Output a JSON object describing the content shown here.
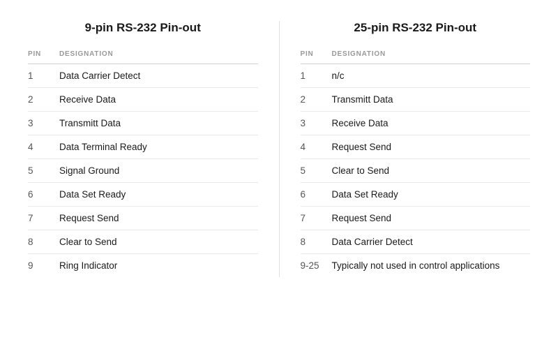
{
  "left_table": {
    "title": "9-pin RS-232 Pin-out",
    "col_pin": "PIN",
    "col_designation": "DESIGNATION",
    "rows": [
      {
        "pin": "1",
        "designation": "Data Carrier Detect"
      },
      {
        "pin": "2",
        "designation": "Receive Data"
      },
      {
        "pin": "3",
        "designation": "Transmitt Data"
      },
      {
        "pin": "4",
        "designation": "Data Terminal Ready"
      },
      {
        "pin": "5",
        "designation": "Signal Ground"
      },
      {
        "pin": "6",
        "designation": "Data Set Ready"
      },
      {
        "pin": "7",
        "designation": "Request Send"
      },
      {
        "pin": "8",
        "designation": "Clear to Send"
      },
      {
        "pin": "9",
        "designation": "Ring Indicator"
      }
    ]
  },
  "right_table": {
    "title": "25-pin RS-232 Pin-out",
    "col_pin": "PIN",
    "col_designation": "DESIGNATION",
    "rows": [
      {
        "pin": "1",
        "designation": "n/c"
      },
      {
        "pin": "2",
        "designation": "Transmitt Data"
      },
      {
        "pin": "3",
        "designation": "Receive Data"
      },
      {
        "pin": "4",
        "designation": "Request Send"
      },
      {
        "pin": "5",
        "designation": "Clear to Send"
      },
      {
        "pin": "6",
        "designation": "Data Set Ready"
      },
      {
        "pin": "7",
        "designation": "Request Send"
      },
      {
        "pin": "8",
        "designation": "Data Carrier Detect"
      },
      {
        "pin": "9-25",
        "designation": "Typically not used in control applications"
      }
    ]
  }
}
